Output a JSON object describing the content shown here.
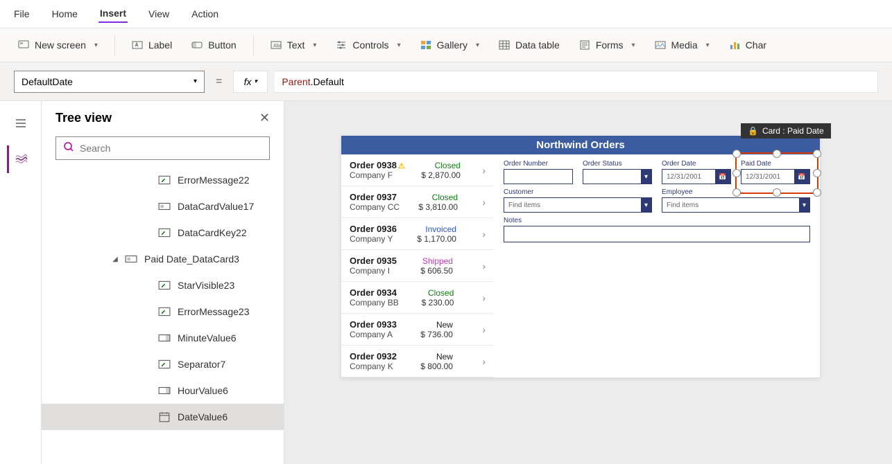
{
  "menu": {
    "file": "File",
    "home": "Home",
    "insert": "Insert",
    "view": "View",
    "action": "Action",
    "active": "Insert"
  },
  "ribbon": {
    "newScreen": "New screen",
    "label": "Label",
    "button": "Button",
    "text": "Text",
    "controls": "Controls",
    "gallery": "Gallery",
    "dataTable": "Data table",
    "forms": "Forms",
    "media": "Media",
    "chart": "Char"
  },
  "formulaBar": {
    "property": "DefaultDate",
    "formula": "Parent.Default"
  },
  "treeView": {
    "title": "Tree view",
    "searchPlaceholder": "Search",
    "nodes": [
      {
        "icon": "edit",
        "label": "ErrorMessage22",
        "depth": 2
      },
      {
        "icon": "card",
        "label": "DataCardValue17",
        "depth": 2
      },
      {
        "icon": "edit",
        "label": "DataCardKey22",
        "depth": 2
      },
      {
        "icon": "card",
        "label": "Paid Date_DataCard3",
        "depth": 1,
        "expanded": true,
        "parent": true
      },
      {
        "icon": "edit",
        "label": "StarVisible23",
        "depth": 2
      },
      {
        "icon": "edit",
        "label": "ErrorMessage23",
        "depth": 2
      },
      {
        "icon": "box",
        "label": "MinuteValue6",
        "depth": 2
      },
      {
        "icon": "edit",
        "label": "Separator7",
        "depth": 2
      },
      {
        "icon": "box",
        "label": "HourValue6",
        "depth": 2
      },
      {
        "icon": "calendar",
        "label": "DateValue6",
        "depth": 2,
        "selected": true
      }
    ]
  },
  "app": {
    "title": "Northwind Orders",
    "orders": [
      {
        "order": "Order 0938",
        "company": "Company F",
        "status": "Closed",
        "amount": "$ 2,870.00",
        "warn": true
      },
      {
        "order": "Order 0937",
        "company": "Company CC",
        "status": "Closed",
        "amount": "$ 3,810.00"
      },
      {
        "order": "Order 0936",
        "company": "Company Y",
        "status": "Invoiced",
        "amount": "$ 1,170.00"
      },
      {
        "order": "Order 0935",
        "company": "Company I",
        "status": "Shipped",
        "amount": "$ 606.50"
      },
      {
        "order": "Order 0934",
        "company": "Company BB",
        "status": "Closed",
        "amount": "$ 230.00"
      },
      {
        "order": "Order 0933",
        "company": "Company A",
        "status": "New",
        "amount": "$ 736.00"
      },
      {
        "order": "Order 0932",
        "company": "Company K",
        "status": "New",
        "amount": "$ 800.00"
      }
    ],
    "form": {
      "orderNumber": "Order Number",
      "orderStatus": "Order Status",
      "orderDate": "Order Date",
      "orderDateValue": "12/31/2001",
      "paidDate": "Paid Date",
      "paidDateValue": "12/31/2001",
      "customer": "Customer",
      "employee": "Employee",
      "findItems": "Find items",
      "notes": "Notes"
    }
  },
  "selection": {
    "label": "Card : Paid Date"
  }
}
